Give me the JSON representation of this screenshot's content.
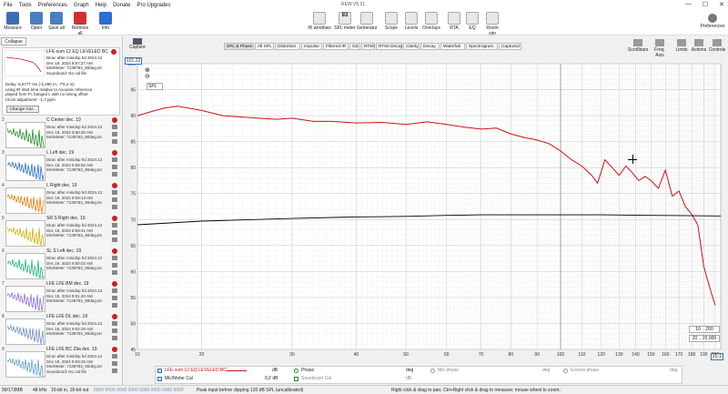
{
  "menubar": [
    "File",
    "Tools",
    "Preferences",
    "Graph",
    "Help",
    "Donate",
    "Pro Upgrades"
  ],
  "window_title": "REW V5.31",
  "win_controls": {
    "min": "—",
    "max": "☐",
    "close": "✕"
  },
  "toolbar_left": [
    {
      "label": "Measure",
      "color": "#3a6fb5"
    },
    {
      "label": "Open",
      "color": "#4a7ec0"
    },
    {
      "label": "Save all",
      "color": "#4a7ec0"
    },
    {
      "label": "Remove all",
      "color": "#d03030"
    },
    {
      "label": "Info",
      "color": "#2a6fd0"
    }
  ],
  "toolbar_center": [
    {
      "label": "IR windows"
    },
    {
      "label": "SPL meter",
      "value": "83"
    },
    {
      "label": "Generator"
    },
    {
      "label": "Scope"
    },
    {
      "label": "Levels"
    },
    {
      "label": "Overlays"
    },
    {
      "label": "RTA"
    },
    {
      "label": "EQ"
    },
    {
      "label": "Room sim"
    }
  ],
  "toolbar_right": {
    "label": "Preferences"
  },
  "sidebar": {
    "collapse_label": "Collapse",
    "selected": {
      "title": "LFE sum 12 EQ LEVELED BC",
      "details": [
        "Dirac after minidsp hd 2024.12",
        "Dec 19, 2024 8:57:27 AM",
        "Mic/Meter: 7138763_90deg.txt",
        "Soundcard: No cal file"
      ],
      "info": [
        "Delay -6,6777 ms (-2,290 m, -7'6,2 in)",
        "using IR start time relative to Acoustic reference",
        "played from Fc hanged L with no timing offset",
        "Clock adjustment: -1,7 ppm"
      ],
      "change_cal": "Change Cal..."
    },
    "measurements": [
      {
        "num": "2",
        "title": "C Center dec. 19",
        "color": "#2a8c2a",
        "details": [
          "Dirac after minidsp hd 2024.12",
          "Dec 19, 2024 8:50:30 AM",
          "Mic/Meter: 7138763_90deg.txt"
        ]
      },
      {
        "num": "3",
        "title": "L Left dec. 19",
        "color": "#2a70d0",
        "details": [
          "Dirac after minidsp hd 2024.12",
          "Dec 19, 2024 8:58:56 AM",
          "Mic/Meter: 7138763_90deg.txt"
        ]
      },
      {
        "num": "4",
        "title": "L Right dec. 19",
        "color": "#e08010",
        "details": [
          "Dirac after minidsp hd 2024.12",
          "Dec 19, 2024 8:59:13 AM",
          "Mic/Meter: 7138763_90deg.txt"
        ]
      },
      {
        "num": "5",
        "title": "SR S Right dec. 19",
        "color": "#d0b010",
        "details": [
          "Dirac after minidsp hd 2024.12",
          "Dec 19, 2024 8:59:41 AM",
          "Mic/Meter: 7138763_90deg.txt"
        ]
      },
      {
        "num": "6",
        "title": "SL S Left dec. 19",
        "color": "#20b080",
        "details": [
          "Dirac after minidsp hd 2024.12",
          "Dec 19, 2024 9:00:02 AM",
          "Mic/Meter: 7138763_90deg.txt"
        ]
      },
      {
        "num": "7",
        "title": "LFE LFE BM dec. 19",
        "color": "#9070d0",
        "details": [
          "Dirac after minidsp hd 2024.12",
          "Dec 19, 2024 9:01:40 AM",
          "Mic/Meter: 7138763_90deg.txt"
        ]
      },
      {
        "num": "8",
        "title": "LFE LFE DL dec. 19",
        "color": "#7090c0",
        "details": [
          "Dirac after minidsp hd 2024.12",
          "Dec 19, 2024 9:02:28 AM",
          "Mic/Meter: 7138763_90deg.txt"
        ]
      },
      {
        "num": "9",
        "title": "LFE LFE BC Zita dec. 19",
        "color": "#60a0c0",
        "details": [
          "Dirac after minidsp hd 2024.12",
          "Dec 19, 2024 9:03:25 AM",
          "Mic/Meter: 7138763_90deg.txt",
          "Soundcard: No cal file"
        ]
      }
    ]
  },
  "capture_label": "Capture",
  "tabs": [
    "SPL & Phase",
    "All SPL",
    "Distortion",
    "Impulse",
    "Filtered IR",
    "GD",
    "RT60",
    "RT60 Decay",
    "Clarity",
    "Decay",
    "Waterfall",
    "Spectrogram",
    "Captured"
  ],
  "right_tools": [
    "Scrollbars",
    "Freq. Axis",
    "Limits",
    "Actions",
    "Controls"
  ],
  "graph": {
    "unit_label": "SPL",
    "top_value": "101.22",
    "right_value": "20.1",
    "zoom_in": "⊕",
    "zoom_out": "⊖",
    "range_buttons": [
      "10 .. 200",
      "20 .. 20,000"
    ]
  },
  "legend": {
    "row1": {
      "name": "LFE sum 12 EQ LEVELED BC",
      "unit": "dB",
      "phase": "Phase",
      "phase_unit": "deg",
      "min_phase": "Min phase",
      "min_phase_unit": "deg",
      "excess_phase": "Excess phase",
      "excess_phase_unit": "deg"
    },
    "row2": {
      "name": "Mic/Meter Cal",
      "value": "0,2 dB",
      "soundcard": "Soundcard Cal",
      "unit": "dB"
    }
  },
  "status": {
    "memory": "99/173MB",
    "rate": "48 kHz",
    "bits": "16-bit in, 16-bit out",
    "levels": "0000 0000 0000 0000 0000 0000 0000 0000",
    "peak": "Peak input before clipping 120 dB SPL (uncalibrated)",
    "hint": "Right click & drag to pan; Ctrl+Right click & drag to measure; mouse wheel to zoom;"
  },
  "chart_data": {
    "type": "line",
    "xscale": "log",
    "xlim": [
      15,
      205
    ],
    "ylim": [
      45,
      100
    ],
    "x_ticks": [
      15,
      20,
      30,
      40,
      50,
      60,
      70,
      80,
      90,
      100,
      110,
      120,
      130,
      140,
      150,
      160,
      170,
      180,
      190,
      200
    ],
    "y_ticks": [
      45,
      50,
      55,
      60,
      65,
      70,
      75,
      80,
      85,
      90,
      95,
      100
    ],
    "series": [
      {
        "name": "LFE sum 12 EQ LEVELED BC",
        "color": "#d01010",
        "x": [
          15,
          16,
          17,
          18,
          20,
          22,
          25,
          28,
          30,
          33,
          36,
          40,
          45,
          50,
          55,
          60,
          65,
          70,
          75,
          80,
          85,
          90,
          95,
          100,
          105,
          110,
          115,
          118,
          122,
          126,
          130,
          134,
          138,
          142,
          146,
          150,
          155,
          160,
          165,
          170,
          175,
          180,
          185,
          190,
          195,
          200
        ],
        "y": [
          90,
          90.8,
          91.5,
          91.8,
          91,
          90,
          89.6,
          89.3,
          89.5,
          88.9,
          88.9,
          88.6,
          88.7,
          88.3,
          88.8,
          88.3,
          87.8,
          87.4,
          87.6,
          86.5,
          85.8,
          85.3,
          84.6,
          83.2,
          81.5,
          80.3,
          78.5,
          77,
          81.5,
          80,
          78.5,
          80.3,
          79,
          77.5,
          78.3,
          77.5,
          76,
          79.5,
          74.5,
          75.5,
          72.5,
          71,
          69,
          61,
          57,
          53.5
        ]
      },
      {
        "name": "",
        "color": "#000000",
        "x": [
          15,
          20,
          30,
          40,
          50,
          60,
          70,
          80,
          100,
          120,
          150,
          200,
          205
        ],
        "y": [
          69,
          69.7,
          70.2,
          70.5,
          70.6,
          70.8,
          70.9,
          70.9,
          70.9,
          70.9,
          70.8,
          70.7,
          70.7
        ]
      }
    ]
  }
}
